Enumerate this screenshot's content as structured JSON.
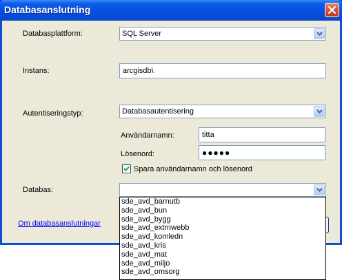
{
  "window": {
    "title": "Databasanslutning"
  },
  "form": {
    "platform_label": "Databasplattform:",
    "platform_value": "SQL Server",
    "instance_label": "Instans:",
    "instance_value": "arcgisdb\\",
    "auth_label": "Autentiseringstyp:",
    "auth_value": "Databasautentisering",
    "username_label": "Användarnamn:",
    "username_value": "titta",
    "password_label": "Lösenord:",
    "password_value": "●●●●●",
    "save_label": "Spara användarnamn och lösenord",
    "save_checked": true,
    "database_label": "Databas:",
    "database_value": ""
  },
  "links": {
    "about": "Om databasanslutningar"
  },
  "dropdown": {
    "items": [
      "sde_avd_barnutb",
      "sde_avd_bun",
      "sde_avd_bygg",
      "sde_avd_extrnwebb",
      "sde_avd_komledn",
      "sde_avd_kris",
      "sde_avd_mat",
      "sde_avd_miljo",
      "sde_avd_omsorg"
    ]
  },
  "colors": {
    "titlebar": "#0650e0",
    "client": "#ece9d8",
    "field_border": "#7f9db9",
    "link": "#0000ff"
  }
}
